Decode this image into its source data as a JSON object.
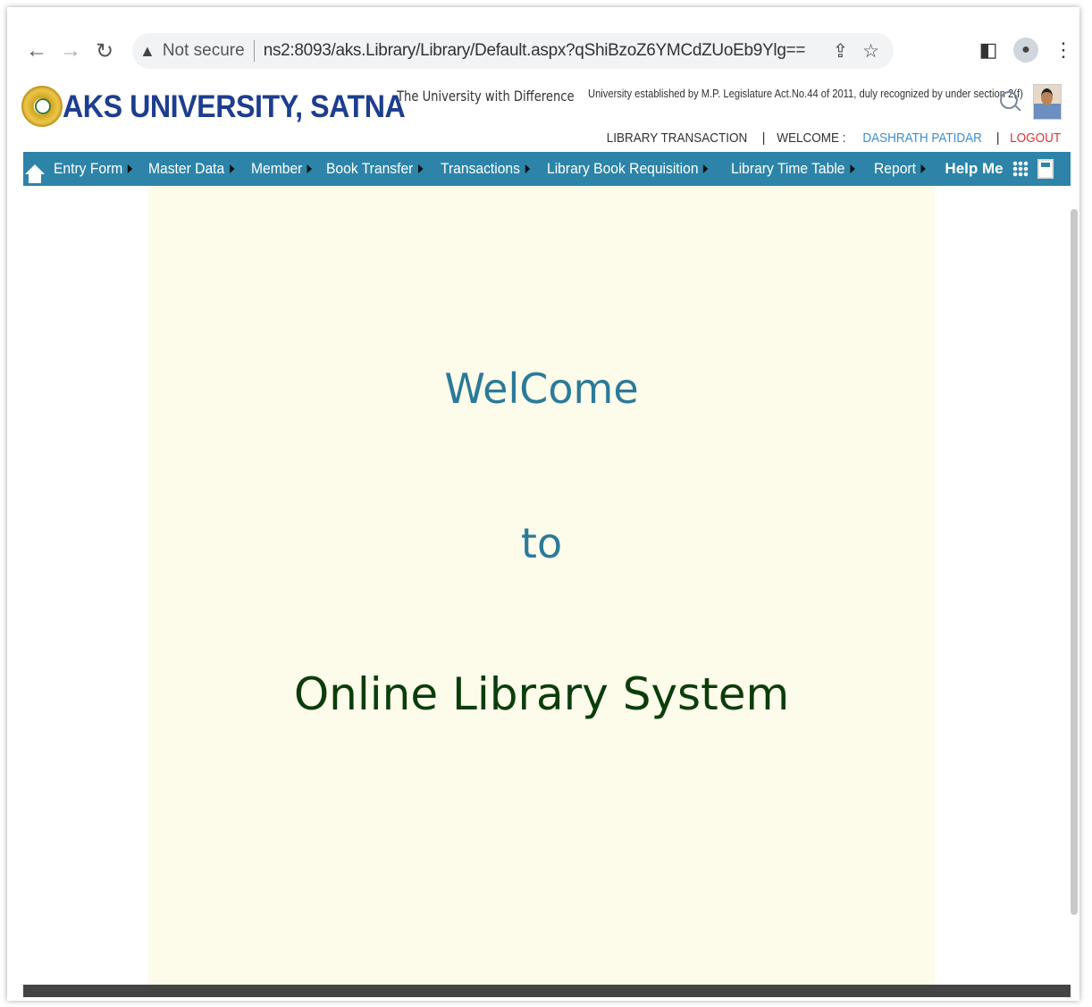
{
  "browser": {
    "security_label": "Not secure",
    "url": "ns2:8093/aks.Library/Library/Default.aspx?qShiBzoZ6YMCdZUoEb9Ylg=="
  },
  "header": {
    "university_name": "AKS UNIVERSITY, SATNA",
    "tagline": "The University with Difference",
    "legal_text": "University established by M.P. Legislature Act.No.44 of 2011, duly recognized by under section 2(f)",
    "module_label": "LIBRARY TRANSACTION",
    "welcome_label": "WELCOME :",
    "user_name": "DASHRATH PATIDAR",
    "separator": "|",
    "logout_label": "LOGOUT"
  },
  "menu": {
    "items": [
      {
        "label": "Entry Form"
      },
      {
        "label": "Master Data"
      },
      {
        "label": "Member"
      },
      {
        "label": "Book Transfer"
      },
      {
        "label": "Transactions"
      },
      {
        "label": "Library Book Requisition"
      },
      {
        "label": "Library Time Table"
      },
      {
        "label": "Report"
      }
    ],
    "help_label": "Help Me"
  },
  "main": {
    "line1": "WelCome",
    "line2": "to",
    "line3": "Online Library System"
  },
  "colors": {
    "menu_bg": "#2d84a8",
    "brand_blue": "#1d3d8f",
    "content_bg": "#fdfbea",
    "welcome_text": "#2b7a99",
    "title_text": "#0b3d0b",
    "logout": "#dd3333"
  }
}
